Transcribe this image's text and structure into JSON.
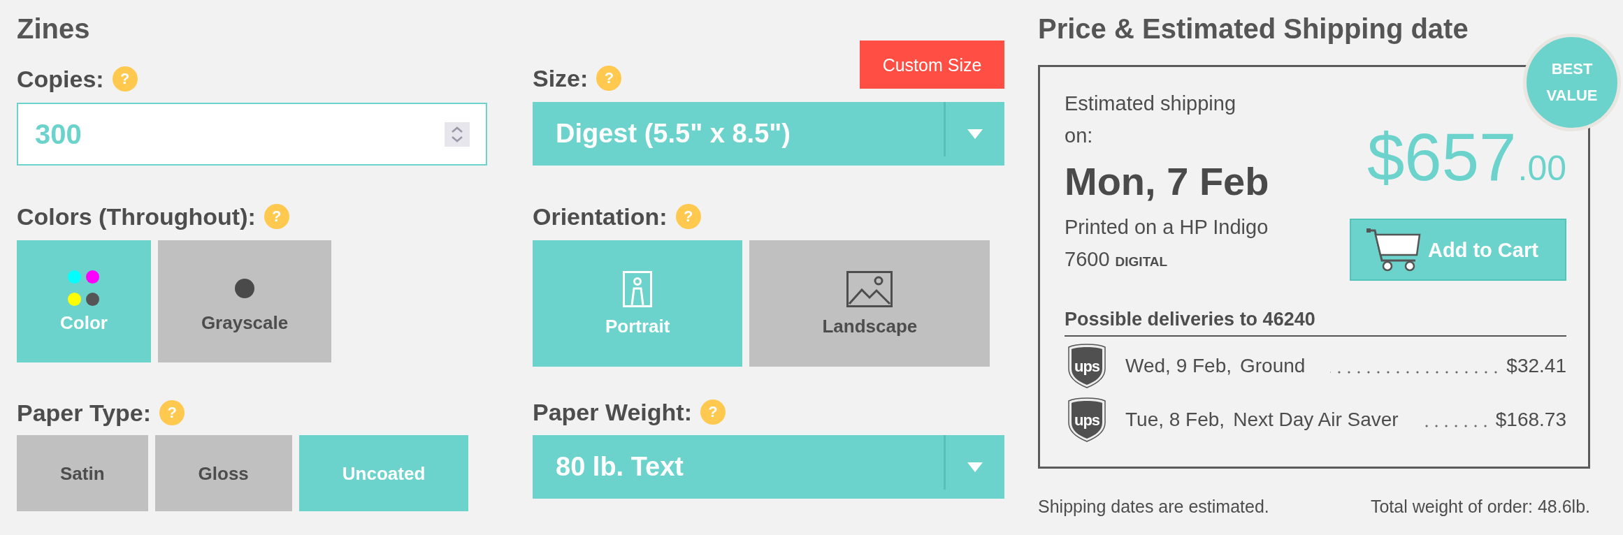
{
  "product": {
    "title": "Zines"
  },
  "copies": {
    "label": "Copies:",
    "help": "?",
    "value": "300"
  },
  "size": {
    "label": "Size:",
    "help": "?",
    "custom_button": "Custom Size",
    "value": "Digest (5.5\" x 8.5\")"
  },
  "colors": {
    "label": "Colors (Throughout):",
    "help": "?",
    "options": [
      {
        "label": "Color",
        "kind": "cmyk",
        "selected": true
      },
      {
        "label": "Grayscale",
        "kind": "gray",
        "selected": false
      }
    ]
  },
  "orientation": {
    "label": "Orientation:",
    "help": "?",
    "options": [
      {
        "label": "Portrait",
        "kind": "portrait",
        "selected": true
      },
      {
        "label": "Landscape",
        "kind": "landscape",
        "selected": false
      }
    ]
  },
  "paper_type": {
    "label": "Paper Type:",
    "help": "?",
    "options": [
      {
        "label": "Satin",
        "selected": false
      },
      {
        "label": "Gloss",
        "selected": false
      },
      {
        "label": "Uncoated",
        "selected": true
      }
    ]
  },
  "paper_weight": {
    "label": "Paper Weight:",
    "help": "?",
    "value": "80 lb. Text"
  },
  "summary": {
    "title": "Price & Estimated Shipping date",
    "badge": "BEST VALUE",
    "shipping_label": "Estimated shipping on:",
    "ship_date": "Mon, 7 Feb",
    "printer": "Printed on a HP Indigo 7600",
    "printer_kind": "DIGITAL",
    "price": "$657",
    "price_cents": ".00",
    "add_to_cart": "Add to Cart",
    "deliveries_title": "Possible deliveries to 46240",
    "deliveries": [
      {
        "logo": "ups",
        "date": "Wed, 9 Feb,",
        "service": "Ground",
        "price": "$32.41"
      },
      {
        "logo": "ups",
        "date": "Tue, 8 Feb,",
        "service": "Next Day Air Saver",
        "price": "$168.73"
      }
    ]
  },
  "footer": {
    "note": "Shipping dates are estimated.",
    "total_weight": "Total weight of order: 48.6lb."
  }
}
